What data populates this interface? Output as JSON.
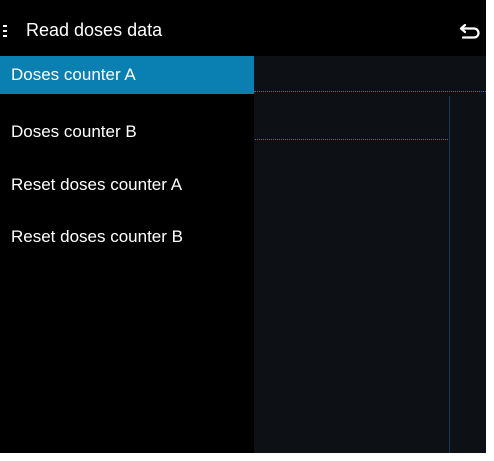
{
  "app_bar": {
    "title": "Read doses data",
    "menu_icon": "menu-icon",
    "back_icon": "back-arrow-icon"
  },
  "menu": {
    "items": [
      {
        "label": "Doses counter A",
        "selected": true
      },
      {
        "label": "Doses counter B",
        "selected": false
      },
      {
        "label": "Reset doses counter A",
        "selected": false
      },
      {
        "label": "Reset doses counter B",
        "selected": false
      }
    ]
  },
  "colors": {
    "background": "#000000",
    "selected_item": "#0a7fb2",
    "text": "#ffffff",
    "guide_line": "#2f6fd6"
  }
}
